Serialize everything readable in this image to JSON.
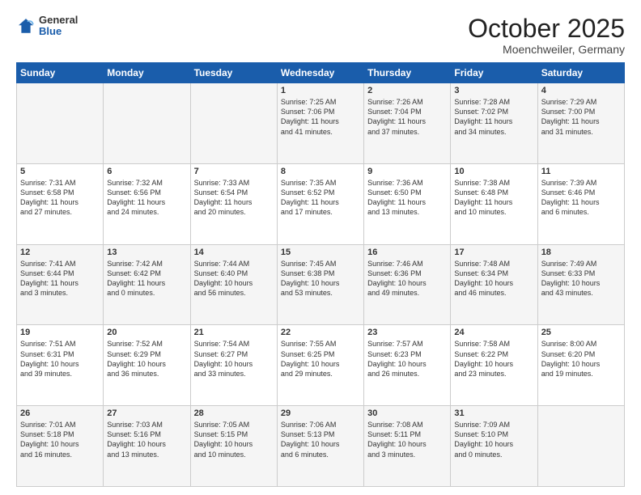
{
  "header": {
    "logo_general": "General",
    "logo_blue": "Blue",
    "month": "October 2025",
    "location": "Moenchweiler, Germany"
  },
  "weekdays": [
    "Sunday",
    "Monday",
    "Tuesday",
    "Wednesday",
    "Thursday",
    "Friday",
    "Saturday"
  ],
  "weeks": [
    [
      {
        "day": "",
        "text": ""
      },
      {
        "day": "",
        "text": ""
      },
      {
        "day": "",
        "text": ""
      },
      {
        "day": "1",
        "text": "Sunrise: 7:25 AM\nSunset: 7:06 PM\nDaylight: 11 hours\nand 41 minutes."
      },
      {
        "day": "2",
        "text": "Sunrise: 7:26 AM\nSunset: 7:04 PM\nDaylight: 11 hours\nand 37 minutes."
      },
      {
        "day": "3",
        "text": "Sunrise: 7:28 AM\nSunset: 7:02 PM\nDaylight: 11 hours\nand 34 minutes."
      },
      {
        "day": "4",
        "text": "Sunrise: 7:29 AM\nSunset: 7:00 PM\nDaylight: 11 hours\nand 31 minutes."
      }
    ],
    [
      {
        "day": "5",
        "text": "Sunrise: 7:31 AM\nSunset: 6:58 PM\nDaylight: 11 hours\nand 27 minutes."
      },
      {
        "day": "6",
        "text": "Sunrise: 7:32 AM\nSunset: 6:56 PM\nDaylight: 11 hours\nand 24 minutes."
      },
      {
        "day": "7",
        "text": "Sunrise: 7:33 AM\nSunset: 6:54 PM\nDaylight: 11 hours\nand 20 minutes."
      },
      {
        "day": "8",
        "text": "Sunrise: 7:35 AM\nSunset: 6:52 PM\nDaylight: 11 hours\nand 17 minutes."
      },
      {
        "day": "9",
        "text": "Sunrise: 7:36 AM\nSunset: 6:50 PM\nDaylight: 11 hours\nand 13 minutes."
      },
      {
        "day": "10",
        "text": "Sunrise: 7:38 AM\nSunset: 6:48 PM\nDaylight: 11 hours\nand 10 minutes."
      },
      {
        "day": "11",
        "text": "Sunrise: 7:39 AM\nSunset: 6:46 PM\nDaylight: 11 hours\nand 6 minutes."
      }
    ],
    [
      {
        "day": "12",
        "text": "Sunrise: 7:41 AM\nSunset: 6:44 PM\nDaylight: 11 hours\nand 3 minutes."
      },
      {
        "day": "13",
        "text": "Sunrise: 7:42 AM\nSunset: 6:42 PM\nDaylight: 11 hours\nand 0 minutes."
      },
      {
        "day": "14",
        "text": "Sunrise: 7:44 AM\nSunset: 6:40 PM\nDaylight: 10 hours\nand 56 minutes."
      },
      {
        "day": "15",
        "text": "Sunrise: 7:45 AM\nSunset: 6:38 PM\nDaylight: 10 hours\nand 53 minutes."
      },
      {
        "day": "16",
        "text": "Sunrise: 7:46 AM\nSunset: 6:36 PM\nDaylight: 10 hours\nand 49 minutes."
      },
      {
        "day": "17",
        "text": "Sunrise: 7:48 AM\nSunset: 6:34 PM\nDaylight: 10 hours\nand 46 minutes."
      },
      {
        "day": "18",
        "text": "Sunrise: 7:49 AM\nSunset: 6:33 PM\nDaylight: 10 hours\nand 43 minutes."
      }
    ],
    [
      {
        "day": "19",
        "text": "Sunrise: 7:51 AM\nSunset: 6:31 PM\nDaylight: 10 hours\nand 39 minutes."
      },
      {
        "day": "20",
        "text": "Sunrise: 7:52 AM\nSunset: 6:29 PM\nDaylight: 10 hours\nand 36 minutes."
      },
      {
        "day": "21",
        "text": "Sunrise: 7:54 AM\nSunset: 6:27 PM\nDaylight: 10 hours\nand 33 minutes."
      },
      {
        "day": "22",
        "text": "Sunrise: 7:55 AM\nSunset: 6:25 PM\nDaylight: 10 hours\nand 29 minutes."
      },
      {
        "day": "23",
        "text": "Sunrise: 7:57 AM\nSunset: 6:23 PM\nDaylight: 10 hours\nand 26 minutes."
      },
      {
        "day": "24",
        "text": "Sunrise: 7:58 AM\nSunset: 6:22 PM\nDaylight: 10 hours\nand 23 minutes."
      },
      {
        "day": "25",
        "text": "Sunrise: 8:00 AM\nSunset: 6:20 PM\nDaylight: 10 hours\nand 19 minutes."
      }
    ],
    [
      {
        "day": "26",
        "text": "Sunrise: 7:01 AM\nSunset: 5:18 PM\nDaylight: 10 hours\nand 16 minutes."
      },
      {
        "day": "27",
        "text": "Sunrise: 7:03 AM\nSunset: 5:16 PM\nDaylight: 10 hours\nand 13 minutes."
      },
      {
        "day": "28",
        "text": "Sunrise: 7:05 AM\nSunset: 5:15 PM\nDaylight: 10 hours\nand 10 minutes."
      },
      {
        "day": "29",
        "text": "Sunrise: 7:06 AM\nSunset: 5:13 PM\nDaylight: 10 hours\nand 6 minutes."
      },
      {
        "day": "30",
        "text": "Sunrise: 7:08 AM\nSunset: 5:11 PM\nDaylight: 10 hours\nand 3 minutes."
      },
      {
        "day": "31",
        "text": "Sunrise: 7:09 AM\nSunset: 5:10 PM\nDaylight: 10 hours\nand 0 minutes."
      },
      {
        "day": "",
        "text": ""
      }
    ]
  ]
}
